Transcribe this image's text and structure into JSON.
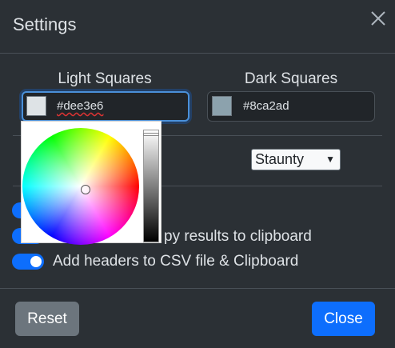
{
  "modal": {
    "title": "Settings"
  },
  "colors": {
    "light_label": "Light Squares",
    "light_value": "#dee3e6",
    "dark_label": "Dark Squares",
    "dark_value": "#8ca2ad",
    "accent": "#0d6efd",
    "reset_bg": "#6c757d"
  },
  "theme_select": {
    "selected": "Staunty"
  },
  "toggles": [
    {
      "label": "",
      "on": true
    },
    {
      "label": "py results to clipboard",
      "on": true
    },
    {
      "label": "Add headers to CSV file & Clipboard",
      "on": true
    }
  ],
  "footer": {
    "reset_label": "Reset",
    "close_label": "Close"
  },
  "icons": {
    "close": "close-icon",
    "select_arrow": "chevron-down-icon"
  }
}
